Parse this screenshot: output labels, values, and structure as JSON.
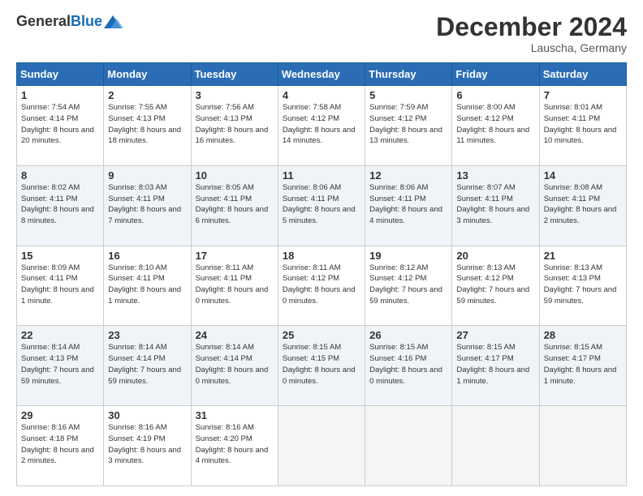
{
  "header": {
    "logo_general": "General",
    "logo_blue": "Blue",
    "month_title": "December 2024",
    "location": "Lauscha, Germany"
  },
  "days_of_week": [
    "Sunday",
    "Monday",
    "Tuesday",
    "Wednesday",
    "Thursday",
    "Friday",
    "Saturday"
  ],
  "weeks": [
    [
      {
        "day": "1",
        "sunrise": "Sunrise: 7:54 AM",
        "sunset": "Sunset: 4:14 PM",
        "daylight": "Daylight: 8 hours and 20 minutes."
      },
      {
        "day": "2",
        "sunrise": "Sunrise: 7:55 AM",
        "sunset": "Sunset: 4:13 PM",
        "daylight": "Daylight: 8 hours and 18 minutes."
      },
      {
        "day": "3",
        "sunrise": "Sunrise: 7:56 AM",
        "sunset": "Sunset: 4:13 PM",
        "daylight": "Daylight: 8 hours and 16 minutes."
      },
      {
        "day": "4",
        "sunrise": "Sunrise: 7:58 AM",
        "sunset": "Sunset: 4:12 PM",
        "daylight": "Daylight: 8 hours and 14 minutes."
      },
      {
        "day": "5",
        "sunrise": "Sunrise: 7:59 AM",
        "sunset": "Sunset: 4:12 PM",
        "daylight": "Daylight: 8 hours and 13 minutes."
      },
      {
        "day": "6",
        "sunrise": "Sunrise: 8:00 AM",
        "sunset": "Sunset: 4:12 PM",
        "daylight": "Daylight: 8 hours and 11 minutes."
      },
      {
        "day": "7",
        "sunrise": "Sunrise: 8:01 AM",
        "sunset": "Sunset: 4:11 PM",
        "daylight": "Daylight: 8 hours and 10 minutes."
      }
    ],
    [
      {
        "day": "8",
        "sunrise": "Sunrise: 8:02 AM",
        "sunset": "Sunset: 4:11 PM",
        "daylight": "Daylight: 8 hours and 8 minutes."
      },
      {
        "day": "9",
        "sunrise": "Sunrise: 8:03 AM",
        "sunset": "Sunset: 4:11 PM",
        "daylight": "Daylight: 8 hours and 7 minutes."
      },
      {
        "day": "10",
        "sunrise": "Sunrise: 8:05 AM",
        "sunset": "Sunset: 4:11 PM",
        "daylight": "Daylight: 8 hours and 6 minutes."
      },
      {
        "day": "11",
        "sunrise": "Sunrise: 8:06 AM",
        "sunset": "Sunset: 4:11 PM",
        "daylight": "Daylight: 8 hours and 5 minutes."
      },
      {
        "day": "12",
        "sunrise": "Sunrise: 8:06 AM",
        "sunset": "Sunset: 4:11 PM",
        "daylight": "Daylight: 8 hours and 4 minutes."
      },
      {
        "day": "13",
        "sunrise": "Sunrise: 8:07 AM",
        "sunset": "Sunset: 4:11 PM",
        "daylight": "Daylight: 8 hours and 3 minutes."
      },
      {
        "day": "14",
        "sunrise": "Sunrise: 8:08 AM",
        "sunset": "Sunset: 4:11 PM",
        "daylight": "Daylight: 8 hours and 2 minutes."
      }
    ],
    [
      {
        "day": "15",
        "sunrise": "Sunrise: 8:09 AM",
        "sunset": "Sunset: 4:11 PM",
        "daylight": "Daylight: 8 hours and 1 minute."
      },
      {
        "day": "16",
        "sunrise": "Sunrise: 8:10 AM",
        "sunset": "Sunset: 4:11 PM",
        "daylight": "Daylight: 8 hours and 1 minute."
      },
      {
        "day": "17",
        "sunrise": "Sunrise: 8:11 AM",
        "sunset": "Sunset: 4:11 PM",
        "daylight": "Daylight: 8 hours and 0 minutes."
      },
      {
        "day": "18",
        "sunrise": "Sunrise: 8:11 AM",
        "sunset": "Sunset: 4:12 PM",
        "daylight": "Daylight: 8 hours and 0 minutes."
      },
      {
        "day": "19",
        "sunrise": "Sunrise: 8:12 AM",
        "sunset": "Sunset: 4:12 PM",
        "daylight": "Daylight: 7 hours and 59 minutes."
      },
      {
        "day": "20",
        "sunrise": "Sunrise: 8:13 AM",
        "sunset": "Sunset: 4:12 PM",
        "daylight": "Daylight: 7 hours and 59 minutes."
      },
      {
        "day": "21",
        "sunrise": "Sunrise: 8:13 AM",
        "sunset": "Sunset: 4:13 PM",
        "daylight": "Daylight: 7 hours and 59 minutes."
      }
    ],
    [
      {
        "day": "22",
        "sunrise": "Sunrise: 8:14 AM",
        "sunset": "Sunset: 4:13 PM",
        "daylight": "Daylight: 7 hours and 59 minutes."
      },
      {
        "day": "23",
        "sunrise": "Sunrise: 8:14 AM",
        "sunset": "Sunset: 4:14 PM",
        "daylight": "Daylight: 7 hours and 59 minutes."
      },
      {
        "day": "24",
        "sunrise": "Sunrise: 8:14 AM",
        "sunset": "Sunset: 4:14 PM",
        "daylight": "Daylight: 8 hours and 0 minutes."
      },
      {
        "day": "25",
        "sunrise": "Sunrise: 8:15 AM",
        "sunset": "Sunset: 4:15 PM",
        "daylight": "Daylight: 8 hours and 0 minutes."
      },
      {
        "day": "26",
        "sunrise": "Sunrise: 8:15 AM",
        "sunset": "Sunset: 4:16 PM",
        "daylight": "Daylight: 8 hours and 0 minutes."
      },
      {
        "day": "27",
        "sunrise": "Sunrise: 8:15 AM",
        "sunset": "Sunset: 4:17 PM",
        "daylight": "Daylight: 8 hours and 1 minute."
      },
      {
        "day": "28",
        "sunrise": "Sunrise: 8:15 AM",
        "sunset": "Sunset: 4:17 PM",
        "daylight": "Daylight: 8 hours and 1 minute."
      }
    ],
    [
      {
        "day": "29",
        "sunrise": "Sunrise: 8:16 AM",
        "sunset": "Sunset: 4:18 PM",
        "daylight": "Daylight: 8 hours and 2 minutes."
      },
      {
        "day": "30",
        "sunrise": "Sunrise: 8:16 AM",
        "sunset": "Sunset: 4:19 PM",
        "daylight": "Daylight: 8 hours and 3 minutes."
      },
      {
        "day": "31",
        "sunrise": "Sunrise: 8:16 AM",
        "sunset": "Sunset: 4:20 PM",
        "daylight": "Daylight: 8 hours and 4 minutes."
      },
      null,
      null,
      null,
      null
    ]
  ]
}
